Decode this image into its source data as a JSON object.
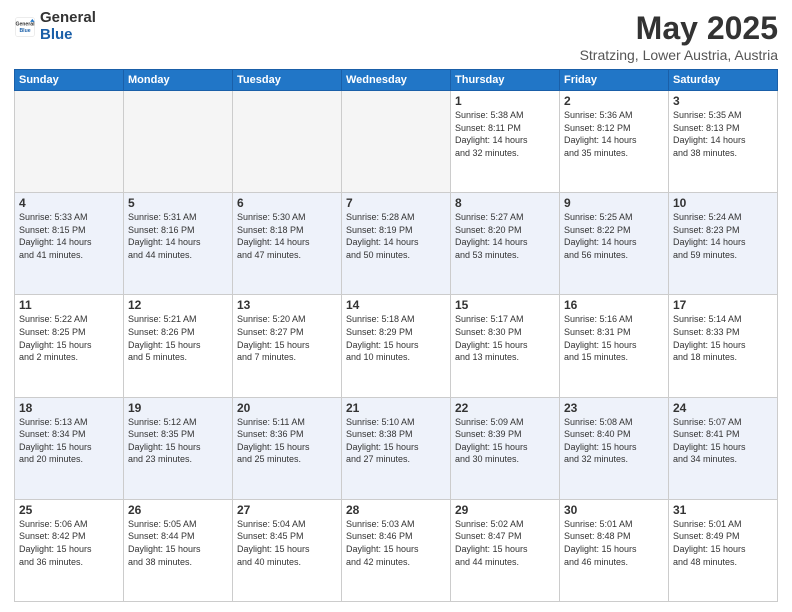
{
  "logo": {
    "general": "General",
    "blue": "Blue"
  },
  "header": {
    "title": "May 2025",
    "subtitle": "Stratzing, Lower Austria, Austria"
  },
  "days_of_week": [
    "Sunday",
    "Monday",
    "Tuesday",
    "Wednesday",
    "Thursday",
    "Friday",
    "Saturday"
  ],
  "weeks": [
    [
      {
        "day": "",
        "info": ""
      },
      {
        "day": "",
        "info": ""
      },
      {
        "day": "",
        "info": ""
      },
      {
        "day": "",
        "info": ""
      },
      {
        "day": "1",
        "info": "Sunrise: 5:38 AM\nSunset: 8:11 PM\nDaylight: 14 hours\nand 32 minutes."
      },
      {
        "day": "2",
        "info": "Sunrise: 5:36 AM\nSunset: 8:12 PM\nDaylight: 14 hours\nand 35 minutes."
      },
      {
        "day": "3",
        "info": "Sunrise: 5:35 AM\nSunset: 8:13 PM\nDaylight: 14 hours\nand 38 minutes."
      }
    ],
    [
      {
        "day": "4",
        "info": "Sunrise: 5:33 AM\nSunset: 8:15 PM\nDaylight: 14 hours\nand 41 minutes."
      },
      {
        "day": "5",
        "info": "Sunrise: 5:31 AM\nSunset: 8:16 PM\nDaylight: 14 hours\nand 44 minutes."
      },
      {
        "day": "6",
        "info": "Sunrise: 5:30 AM\nSunset: 8:18 PM\nDaylight: 14 hours\nand 47 minutes."
      },
      {
        "day": "7",
        "info": "Sunrise: 5:28 AM\nSunset: 8:19 PM\nDaylight: 14 hours\nand 50 minutes."
      },
      {
        "day": "8",
        "info": "Sunrise: 5:27 AM\nSunset: 8:20 PM\nDaylight: 14 hours\nand 53 minutes."
      },
      {
        "day": "9",
        "info": "Sunrise: 5:25 AM\nSunset: 8:22 PM\nDaylight: 14 hours\nand 56 minutes."
      },
      {
        "day": "10",
        "info": "Sunrise: 5:24 AM\nSunset: 8:23 PM\nDaylight: 14 hours\nand 59 minutes."
      }
    ],
    [
      {
        "day": "11",
        "info": "Sunrise: 5:22 AM\nSunset: 8:25 PM\nDaylight: 15 hours\nand 2 minutes."
      },
      {
        "day": "12",
        "info": "Sunrise: 5:21 AM\nSunset: 8:26 PM\nDaylight: 15 hours\nand 5 minutes."
      },
      {
        "day": "13",
        "info": "Sunrise: 5:20 AM\nSunset: 8:27 PM\nDaylight: 15 hours\nand 7 minutes."
      },
      {
        "day": "14",
        "info": "Sunrise: 5:18 AM\nSunset: 8:29 PM\nDaylight: 15 hours\nand 10 minutes."
      },
      {
        "day": "15",
        "info": "Sunrise: 5:17 AM\nSunset: 8:30 PM\nDaylight: 15 hours\nand 13 minutes."
      },
      {
        "day": "16",
        "info": "Sunrise: 5:16 AM\nSunset: 8:31 PM\nDaylight: 15 hours\nand 15 minutes."
      },
      {
        "day": "17",
        "info": "Sunrise: 5:14 AM\nSunset: 8:33 PM\nDaylight: 15 hours\nand 18 minutes."
      }
    ],
    [
      {
        "day": "18",
        "info": "Sunrise: 5:13 AM\nSunset: 8:34 PM\nDaylight: 15 hours\nand 20 minutes."
      },
      {
        "day": "19",
        "info": "Sunrise: 5:12 AM\nSunset: 8:35 PM\nDaylight: 15 hours\nand 23 minutes."
      },
      {
        "day": "20",
        "info": "Sunrise: 5:11 AM\nSunset: 8:36 PM\nDaylight: 15 hours\nand 25 minutes."
      },
      {
        "day": "21",
        "info": "Sunrise: 5:10 AM\nSunset: 8:38 PM\nDaylight: 15 hours\nand 27 minutes."
      },
      {
        "day": "22",
        "info": "Sunrise: 5:09 AM\nSunset: 8:39 PM\nDaylight: 15 hours\nand 30 minutes."
      },
      {
        "day": "23",
        "info": "Sunrise: 5:08 AM\nSunset: 8:40 PM\nDaylight: 15 hours\nand 32 minutes."
      },
      {
        "day": "24",
        "info": "Sunrise: 5:07 AM\nSunset: 8:41 PM\nDaylight: 15 hours\nand 34 minutes."
      }
    ],
    [
      {
        "day": "25",
        "info": "Sunrise: 5:06 AM\nSunset: 8:42 PM\nDaylight: 15 hours\nand 36 minutes."
      },
      {
        "day": "26",
        "info": "Sunrise: 5:05 AM\nSunset: 8:44 PM\nDaylight: 15 hours\nand 38 minutes."
      },
      {
        "day": "27",
        "info": "Sunrise: 5:04 AM\nSunset: 8:45 PM\nDaylight: 15 hours\nand 40 minutes."
      },
      {
        "day": "28",
        "info": "Sunrise: 5:03 AM\nSunset: 8:46 PM\nDaylight: 15 hours\nand 42 minutes."
      },
      {
        "day": "29",
        "info": "Sunrise: 5:02 AM\nSunset: 8:47 PM\nDaylight: 15 hours\nand 44 minutes."
      },
      {
        "day": "30",
        "info": "Sunrise: 5:01 AM\nSunset: 8:48 PM\nDaylight: 15 hours\nand 46 minutes."
      },
      {
        "day": "31",
        "info": "Sunrise: 5:01 AM\nSunset: 8:49 PM\nDaylight: 15 hours\nand 48 minutes."
      }
    ]
  ]
}
